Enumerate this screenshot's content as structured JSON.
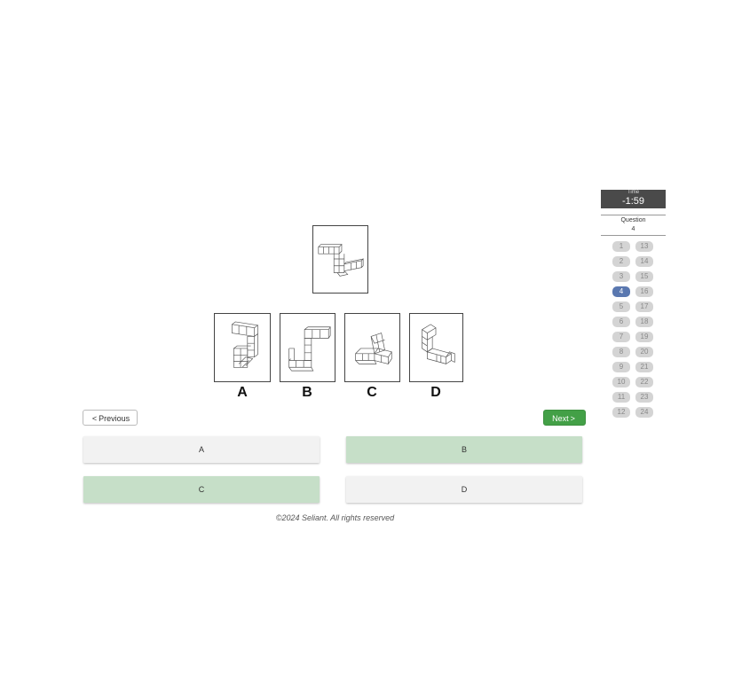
{
  "question": {
    "choice_labels": [
      "A",
      "B",
      "C",
      "D"
    ]
  },
  "navigation": {
    "previous_label": "Previous",
    "next_label": "Next"
  },
  "answers": [
    {
      "label": "A",
      "state": "default"
    },
    {
      "label": "B",
      "state": "highlighted"
    },
    {
      "label": "C",
      "state": "highlighted"
    },
    {
      "label": "D",
      "state": "default"
    }
  ],
  "footer": {
    "copyright": "©2024 Seliant. All rights reserved"
  },
  "sidebar": {
    "timer_label": "Time",
    "timer_value": "-1:59",
    "question_label": "Question",
    "question_value": "4",
    "question_numbers": [
      "1",
      "2",
      "3",
      "4",
      "5",
      "6",
      "7",
      "8",
      "9",
      "10",
      "11",
      "12",
      "13",
      "14",
      "15",
      "16",
      "17",
      "18",
      "19",
      "20",
      "21",
      "22",
      "23",
      "24"
    ],
    "current_question": "4"
  },
  "colors": {
    "accent_green": "#43a047",
    "selected_answer": "#c6dfc8",
    "active_question": "#5a78b0",
    "timer_bg": "#4a4a4a"
  }
}
